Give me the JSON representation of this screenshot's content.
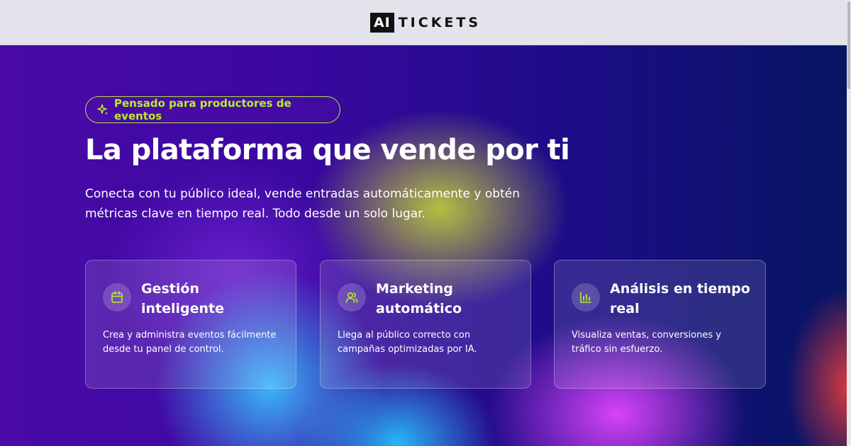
{
  "header": {
    "logo_box": "AI",
    "logo_text": "TICKETS"
  },
  "hero": {
    "badge": "Pensado para productores de eventos",
    "headline": "La plataforma que vende por ti",
    "subtitle": "Conecta con tu público ideal, vende entradas automáticamente y obtén métricas clave en tiempo real. Todo desde un solo lugar."
  },
  "features": [
    {
      "icon": "calendar-icon",
      "title": "Gestión inteligente",
      "text": "Crea y administra eventos fácilmente desde tu panel de control."
    },
    {
      "icon": "users-icon",
      "title": "Marketing automático",
      "text": "Llega al público correcto con campañas optimizadas por IA."
    },
    {
      "icon": "bar-chart-icon",
      "title": "Análisis en tiempo real",
      "text": "Visualiza ventas, conversiones y tráfico sin esfuerzo."
    }
  ],
  "colors": {
    "accent": "#b8ec30",
    "header_bg": "#e4e2ea"
  }
}
